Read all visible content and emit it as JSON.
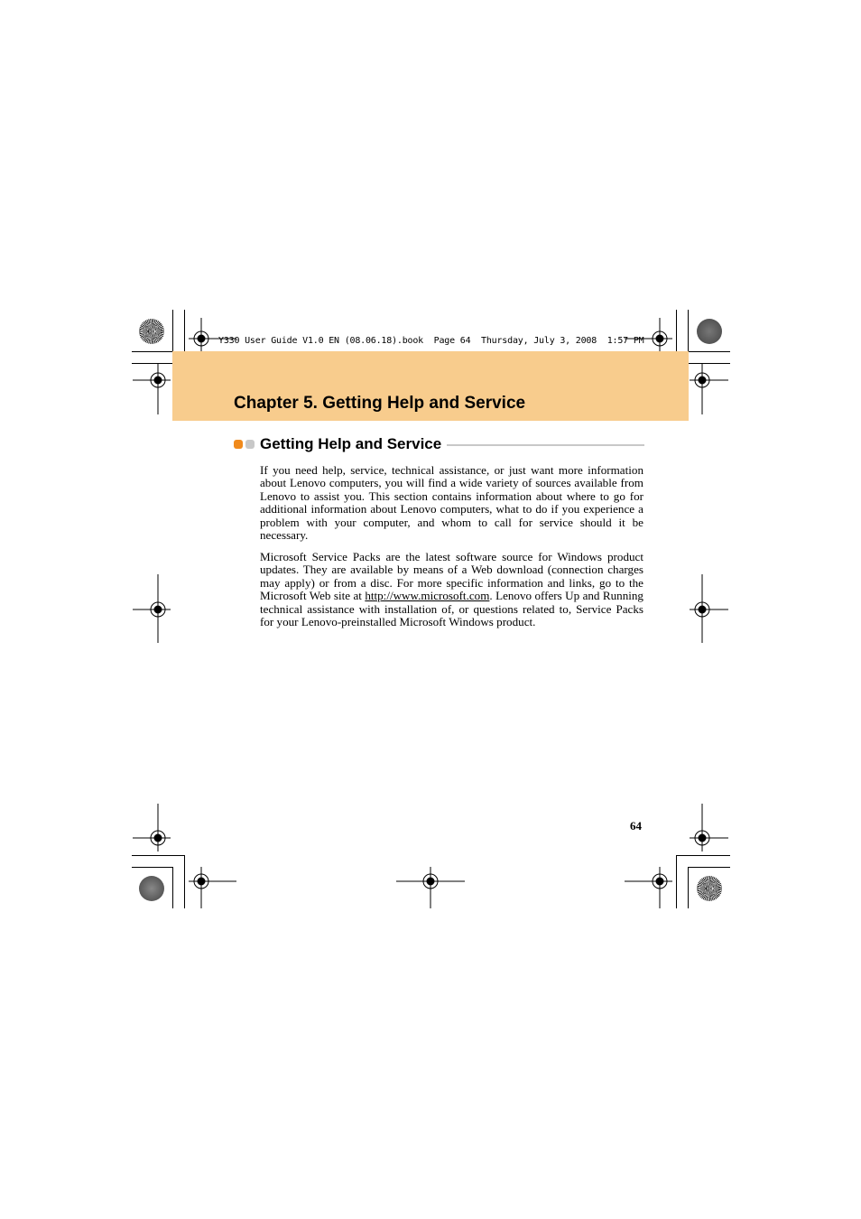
{
  "print_slug": "Y330 User Guide V1.0 EN (08.06.18).book  Page 64  Thursday, July 3, 2008  1:57 PM",
  "chapter": {
    "title": "Chapter 5. Getting Help and Service",
    "banner_color": "#f8cc8d"
  },
  "section": {
    "title": "Getting Help and Service",
    "bullet_colors": [
      "#f08a1c",
      "#c8c8c8"
    ],
    "paragraphs": [
      {
        "text": "If you need help, service, technical assistance, or just want more information about Lenovo computers, you will find a wide variety of sources available from Lenovo to assist you. This section contains information about where to go for additional information about Lenovo computers, what to do if you experience a problem with your computer, and whom to call for service should it be necessary."
      },
      {
        "text_before_link": "Microsoft Service Packs are the latest software source for Windows product updates. They are available by means of a Web download (connection charges may apply) or from a disc. For more specific information and links, go to the Microsoft Web site at ",
        "link_text": "http://www.microsoft.com",
        "text_after_link": ". Lenovo offers Up and Running technical assistance with installation of, or questions related to, Service Packs for your Lenovo-preinstalled Microsoft Windows product."
      }
    ]
  },
  "page_number": "64",
  "icons": {
    "registration_mark": "crosshair-circle",
    "color_disc": "radial-calibration-disc"
  }
}
